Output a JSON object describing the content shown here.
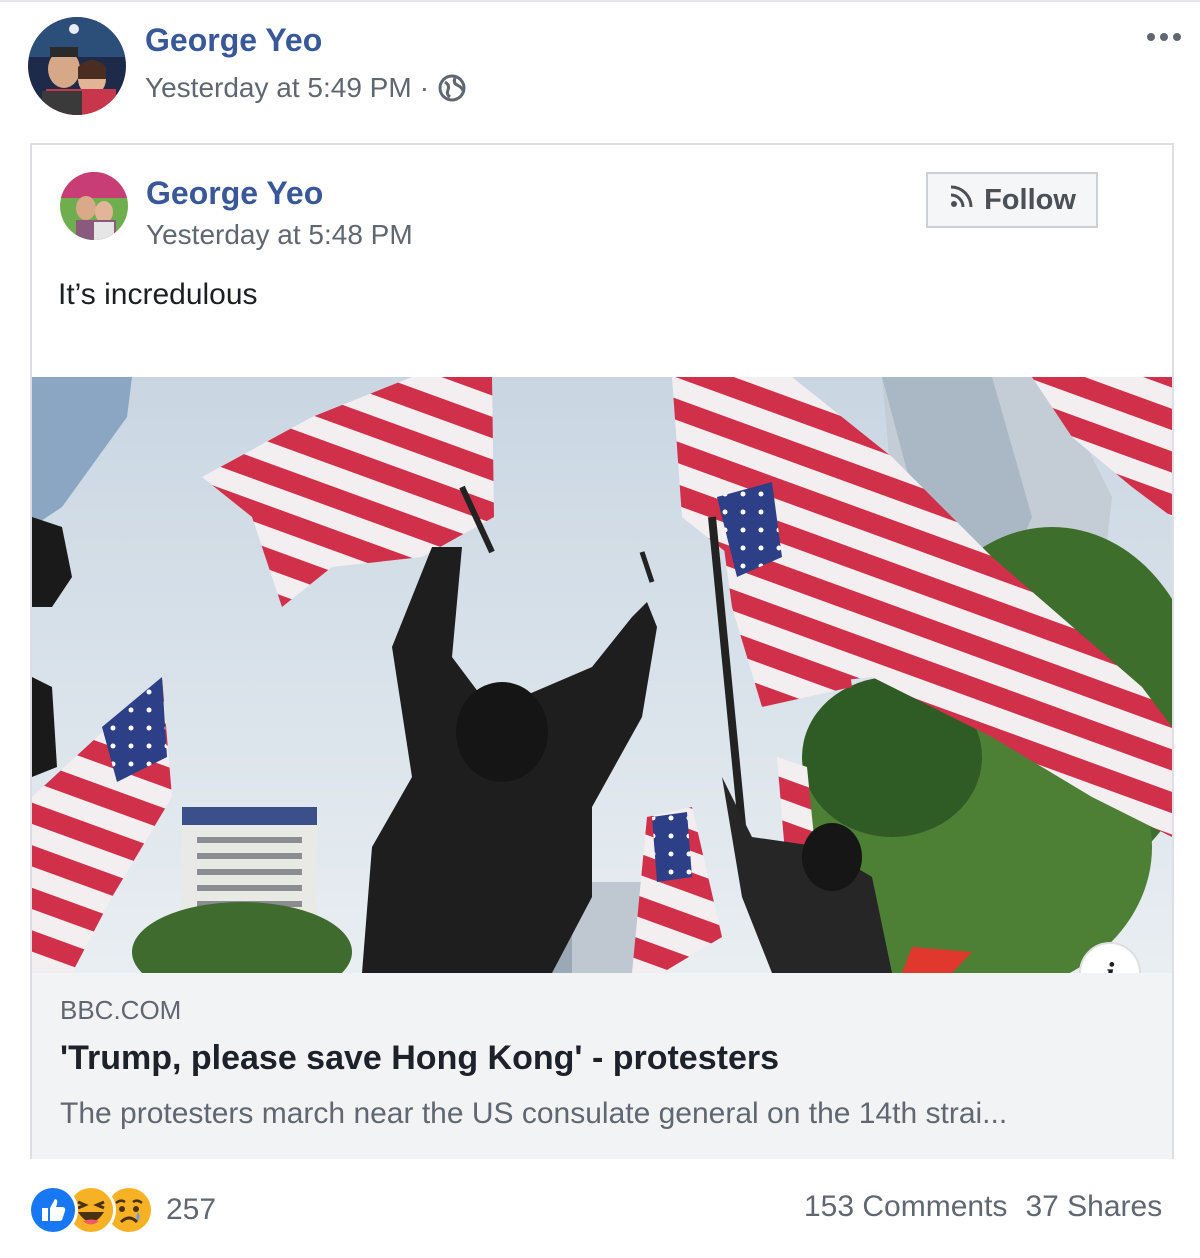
{
  "post": {
    "author": "George Yeo",
    "timestamp": "Yesterday at 5:49 PM",
    "separator": "·",
    "privacy_icon": "globe-icon",
    "more_icon": "more-options-icon"
  },
  "shared_post": {
    "author": "George Yeo",
    "timestamp": "Yesterday at 5:48 PM",
    "follow_label": "Follow",
    "follow_icon": "rss-icon",
    "text": "It’s incredulous"
  },
  "link_preview": {
    "info_label": "i",
    "domain": "BBC.COM",
    "title": "'Trump, please save Hong Kong' - protesters",
    "description": "The protesters march near the US consulate general on the 14th strai..."
  },
  "footer": {
    "reaction_icons": [
      "like-icon",
      "haha-icon",
      "sad-icon"
    ],
    "reaction_count": "257",
    "comments": "153 Comments",
    "shares": "37 Shares"
  },
  "colors": {
    "name": "#385898",
    "meta": "#606770",
    "like_blue": "#1877f2",
    "emoji_yellow": "#f7b125"
  }
}
